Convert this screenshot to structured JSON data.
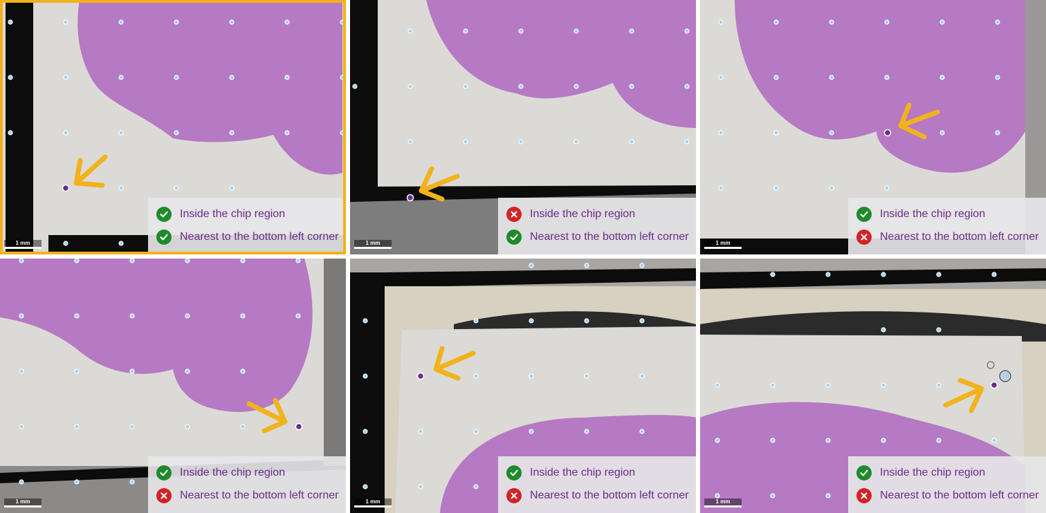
{
  "colors": {
    "pass": "#1f8a2b",
    "fail": "#d32226",
    "label_text": "#6a2a86",
    "highlight": "#f2b21c",
    "fiducial": "#9fd0f2",
    "candidate": "#6b2c8a",
    "tissue": "#b679c3"
  },
  "panels": [
    {
      "selected": true,
      "scale_label": "1 mm",
      "criteria": [
        {
          "label": "Inside the chip region",
          "status": "pass",
          "icon": "check-icon"
        },
        {
          "label": "Nearest to the bottom left corner",
          "status": "pass",
          "icon": "check-icon"
        }
      ]
    },
    {
      "selected": false,
      "scale_label": "1 mm",
      "criteria": [
        {
          "label": "Inside the chip region",
          "status": "fail",
          "icon": "cross-icon"
        },
        {
          "label": "Nearest to the bottom left corner",
          "status": "pass",
          "icon": "check-icon"
        }
      ]
    },
    {
      "selected": false,
      "scale_label": "1 mm",
      "criteria": [
        {
          "label": "Inside the chip region",
          "status": "pass",
          "icon": "check-icon"
        },
        {
          "label": "Nearest to the bottom left corner",
          "status": "fail",
          "icon": "cross-icon"
        }
      ]
    },
    {
      "selected": false,
      "scale_label": "1 mm",
      "criteria": [
        {
          "label": "Inside the chip region",
          "status": "pass",
          "icon": "check-icon"
        },
        {
          "label": "Nearest to the bottom left corner",
          "status": "fail",
          "icon": "cross-icon"
        }
      ]
    },
    {
      "selected": false,
      "scale_label": "1 mm",
      "criteria": [
        {
          "label": "Inside the chip region",
          "status": "pass",
          "icon": "check-icon"
        },
        {
          "label": "Nearest to the bottom left corner",
          "status": "fail",
          "icon": "cross-icon"
        }
      ]
    },
    {
      "selected": false,
      "scale_label": "1 mm",
      "criteria": [
        {
          "label": "Inside the chip region",
          "status": "pass",
          "icon": "check-icon"
        },
        {
          "label": "Nearest to the bottom left corner",
          "status": "fail",
          "icon": "cross-icon"
        }
      ]
    }
  ]
}
